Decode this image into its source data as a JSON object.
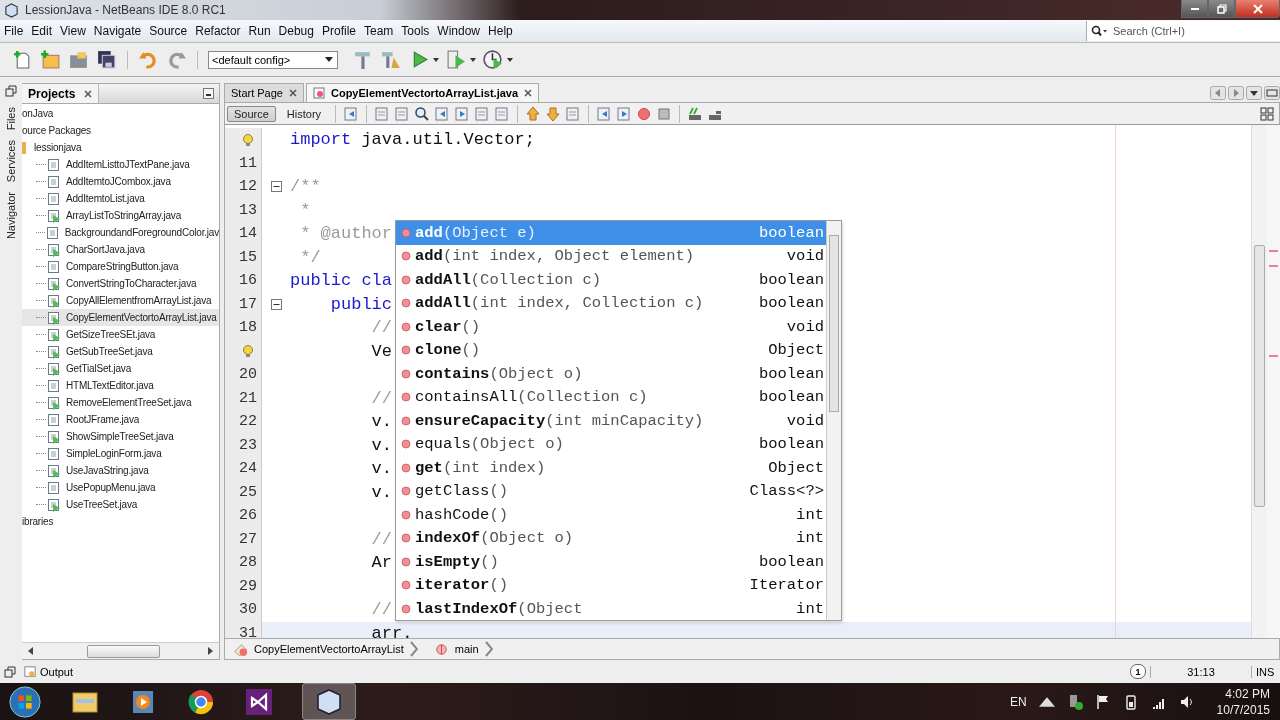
{
  "window": {
    "title": "LessionJava - NetBeans IDE 8.0 RC1"
  },
  "menu": [
    "File",
    "Edit",
    "View",
    "Navigate",
    "Source",
    "Refactor",
    "Run",
    "Debug",
    "Profile",
    "Team",
    "Tools",
    "Window",
    "Help"
  ],
  "search": {
    "placeholder": "Search (Ctrl+I)"
  },
  "toolbar": {
    "config": "<default config>"
  },
  "side_tabs": [
    "Files",
    "Services",
    "Navigator"
  ],
  "projects": {
    "title": "Projects",
    "tree": [
      {
        "label": "onJava",
        "selected": false,
        "children": [
          {
            "label": "ource Packages",
            "selected": false,
            "children": [
              {
                "label": "lessionjava",
                "kind": "package",
                "selected": false,
                "children": [
                  {
                    "label": "AddItemListtoJTextPane.java",
                    "kind": "plain",
                    "selected": false
                  },
                  {
                    "label": "AddItemtoJCombox.java",
                    "kind": "plain",
                    "selected": false
                  },
                  {
                    "label": "AddItemtoList.java",
                    "kind": "plain",
                    "selected": false
                  },
                  {
                    "label": "ArrayListToStringArray.java",
                    "kind": "main",
                    "selected": false
                  },
                  {
                    "label": "BackgroundandForegroundColor.jav",
                    "kind": "plain",
                    "selected": false
                  },
                  {
                    "label": "CharSortJava.java",
                    "kind": "main",
                    "selected": false
                  },
                  {
                    "label": "CompareStringButton.java",
                    "kind": "plain",
                    "selected": false
                  },
                  {
                    "label": "ConvertStringToCharacter.java",
                    "kind": "main",
                    "selected": false
                  },
                  {
                    "label": "CopyAllElementfromArrayList.java",
                    "kind": "main",
                    "selected": false
                  },
                  {
                    "label": "CopyElementVectortoArrayList.java",
                    "kind": "main",
                    "selected": true
                  },
                  {
                    "label": "GetSizeTreeSEt.java",
                    "kind": "main",
                    "selected": false
                  },
                  {
                    "label": "GetSubTreeSet.java",
                    "kind": "main",
                    "selected": false
                  },
                  {
                    "label": "GetTialSet.java",
                    "kind": "main",
                    "selected": false
                  },
                  {
                    "label": "HTMLTextEditor.java",
                    "kind": "plain",
                    "selected": false
                  },
                  {
                    "label": "RemoveElementTreeSet.java",
                    "kind": "main",
                    "selected": false
                  },
                  {
                    "label": "RootJFrame.java",
                    "kind": "plain",
                    "selected": false
                  },
                  {
                    "label": "ShowSimpleTreeSet.java",
                    "kind": "main",
                    "selected": false
                  },
                  {
                    "label": "SimpleLoginForm.java",
                    "kind": "plain",
                    "selected": false
                  },
                  {
                    "label": "UseJavaString.java",
                    "kind": "main",
                    "selected": false
                  },
                  {
                    "label": "UsePopupMenu.java",
                    "kind": "plain",
                    "selected": false
                  },
                  {
                    "label": "UseTreeSet.java",
                    "kind": "main",
                    "selected": false
                  }
                ]
              }
            ]
          },
          {
            "label": "ibraries",
            "selected": false
          }
        ]
      }
    ]
  },
  "editor": {
    "tabs": [
      {
        "label": "Start Page",
        "selected": false
      },
      {
        "label": "CopyElementVectortoArrayList.java",
        "selected": true
      }
    ],
    "views": [
      {
        "label": "Source",
        "selected": true
      },
      {
        "label": "History",
        "selected": false
      }
    ],
    "lines": [
      {
        "kind": "hint",
        "parts": [
          {
            "text": "import",
            "kind": "keyword"
          },
          {
            "text": " java.util.Vector;",
            "kind": "plain"
          }
        ]
      },
      {
        "number": "11",
        "kind": "plain"
      },
      {
        "number": "12",
        "kind": "fold",
        "parts": [
          {
            "text": "/**",
            "kind": "comment"
          }
        ]
      },
      {
        "number": "13",
        "kind": "plain",
        "parts": [
          {
            "text": " *",
            "kind": "comment"
          }
        ]
      },
      {
        "number": "14",
        "kind": "plain",
        "parts": [
          {
            "text": " * @author",
            "kind": "comment"
          }
        ]
      },
      {
        "number": "15",
        "kind": "plain",
        "parts": [
          {
            "text": " */",
            "kind": "comment"
          }
        ]
      },
      {
        "number": "16",
        "kind": "plain",
        "parts": [
          {
            "text": "public cla",
            "kind": "keyword"
          }
        ]
      },
      {
        "number": "17",
        "kind": "fold",
        "parts": [
          {
            "text": "    public",
            "kind": "keyword"
          }
        ]
      },
      {
        "number": "18",
        "kind": "plain",
        "parts": [
          {
            "text": "        //",
            "kind": "comment"
          }
        ]
      },
      {
        "kind": "hint",
        "parts": [
          {
            "text": "        Ve",
            "kind": "plain"
          }
        ]
      },
      {
        "number": "20",
        "kind": "plain"
      },
      {
        "number": "21",
        "kind": "plain",
        "parts": [
          {
            "text": "        //",
            "kind": "comment"
          }
        ]
      },
      {
        "number": "22",
        "kind": "plain",
        "parts": [
          {
            "text": "        v.",
            "kind": "plain"
          }
        ]
      },
      {
        "number": "23",
        "kind": "plain",
        "parts": [
          {
            "text": "        v.",
            "kind": "plain"
          }
        ]
      },
      {
        "number": "24",
        "kind": "plain",
        "parts": [
          {
            "text": "        v.",
            "kind": "plain"
          }
        ]
      },
      {
        "number": "25",
        "kind": "plain",
        "parts": [
          {
            "text": "        v.",
            "kind": "plain"
          }
        ]
      },
      {
        "number": "26",
        "kind": "plain"
      },
      {
        "number": "27",
        "kind": "plain",
        "parts": [
          {
            "text": "        //",
            "kind": "comment"
          }
        ]
      },
      {
        "number": "28",
        "kind": "plain",
        "parts": [
          {
            "text": "        Ar",
            "kind": "plain"
          }
        ]
      },
      {
        "number": "29",
        "kind": "plain"
      },
      {
        "number": "30",
        "kind": "plain",
        "parts": [
          {
            "text": "        //",
            "kind": "comment"
          }
        ]
      },
      {
        "number": "31",
        "kind": "current",
        "parts": [
          {
            "text": "        arr.",
            "kind": "plain"
          }
        ]
      }
    ],
    "completion": [
      {
        "name": "add",
        "params": "(Object e)",
        "returns": "boolean",
        "inherited": false,
        "selected": true
      },
      {
        "name": "add",
        "params": "(int index, Object element)",
        "returns": "void",
        "inherited": false,
        "selected": false
      },
      {
        "name": "addAll",
        "params": "(Collection c)",
        "returns": "boolean",
        "inherited": false,
        "selected": false
      },
      {
        "name": "addAll",
        "params": "(int index, Collection c)",
        "returns": "boolean",
        "inherited": false,
        "selected": false
      },
      {
        "name": "clear",
        "params": "()",
        "returns": "void",
        "inherited": false,
        "selected": false
      },
      {
        "name": "clone",
        "params": "()",
        "returns": "Object",
        "inherited": false,
        "selected": false
      },
      {
        "name": "contains",
        "params": "(Object o)",
        "returns": "boolean",
        "inherited": false,
        "selected": false
      },
      {
        "name": "containsAll",
        "params": "(Collection c)",
        "returns": "boolean",
        "inherited": true,
        "selected": false
      },
      {
        "name": "ensureCapacity",
        "params": "(int minCapacity)",
        "returns": "void",
        "inherited": false,
        "selected": false
      },
      {
        "name": "equals",
        "params": "(Object o)",
        "returns": "boolean",
        "inherited": true,
        "selected": false
      },
      {
        "name": "get",
        "params": "(int index)",
        "returns": "Object",
        "inherited": false,
        "selected": false
      },
      {
        "name": "getClass",
        "params": "()",
        "returns": "Class<?>",
        "inherited": true,
        "selected": false
      },
      {
        "name": "hashCode",
        "params": "()",
        "returns": "int",
        "inherited": true,
        "selected": false
      },
      {
        "name": "indexOf",
        "params": "(Object o)",
        "returns": "int",
        "inherited": false,
        "selected": false
      },
      {
        "name": "isEmpty",
        "params": "()",
        "returns": "boolean",
        "inherited": false,
        "selected": false
      },
      {
        "name": "iterator",
        "params": "()",
        "returns": "Iterator",
        "inherited": false,
        "selected": false
      },
      {
        "name": "lastIndexOf",
        "params": "(Object",
        "returns": "int",
        "inherited": false,
        "selected": false
      }
    ],
    "breadcrumb": [
      "CopyElementVectortoArrayList",
      "main"
    ]
  },
  "output": {
    "label": "Output"
  },
  "status": {
    "notifications": "1",
    "position": "31:13",
    "mode": "INS"
  },
  "tray": {
    "language": "EN",
    "time": "4:02 PM",
    "date": "10/7/2015"
  }
}
